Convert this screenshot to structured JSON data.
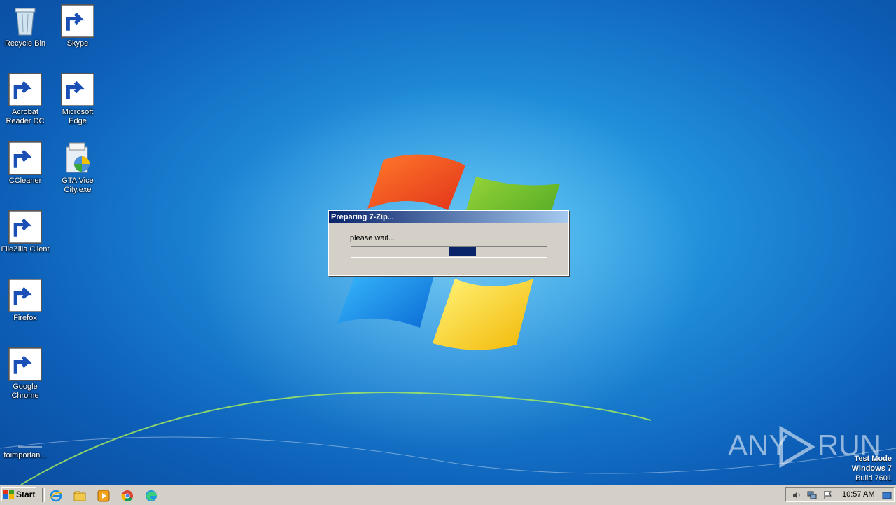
{
  "desktop": {
    "icons": [
      {
        "label": "Recycle Bin"
      },
      {
        "label": "Skype"
      },
      {
        "label": "Acrobat Reader DC"
      },
      {
        "label": "Microsoft Edge"
      },
      {
        "label": "CCleaner"
      },
      {
        "label": "GTA Vice City.exe"
      },
      {
        "label": "FileZilla Client"
      },
      {
        "label": "Firefox"
      },
      {
        "label": "Google Chrome"
      },
      {
        "label": "toimportan..."
      }
    ]
  },
  "dialog": {
    "title": "Preparing 7-Zip...",
    "message": "please wait...",
    "progress": 0.58
  },
  "watermark": {
    "brand_left": "ANY",
    "brand_right": "RUN",
    "test_mode": "Test Mode",
    "os": "Windows 7",
    "build": "Build 7601"
  },
  "taskbar": {
    "start_label": "Start",
    "clock": "10:57 AM"
  }
}
